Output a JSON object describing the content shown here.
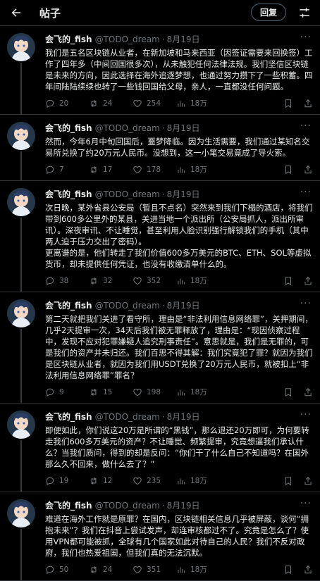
{
  "topbar": {
    "title": "帖子",
    "reply_label": "回复"
  },
  "posts": [
    {
      "name": "会飞的_fish",
      "handle": "@TODO_dream",
      "date": "8月19日",
      "text": "我们是五名区块链从业者，在新加坡和马来西亚（因签证需要来回换签）工作了四年多（中间回国很多次），从未触犯任何法律法规。我们坚信区块链是未来的方向，因此选择在海外追逐梦想，也通过努力攒下了一些积蓄。四年间陆陆续续也转了一些钱回国给父母，亲人，一直都没任何问题。",
      "replies": "20",
      "reposts": "24",
      "likes": "254",
      "views": "18万"
    },
    {
      "name": "会飞的_fish",
      "handle": "@TODO_dream",
      "date": "8月19日",
      "text": "然而，今年6月中旬回国后，噩梦降临。因为生活需要，我们通过某知名交易所兑换了约20万元人民币。没想到，这一小笔交易竟成了导火索。",
      "replies": "7",
      "reposts": "17",
      "likes": "178",
      "views": "18万"
    },
    {
      "name": "会飞的_fish",
      "handle": "@TODO_dream",
      "date": "8月19日",
      "text": "次日晚，某外省县公安局（暂且不点名）突然来到我们下榻的酒店，将我们带到600多公里外的某县，关进当地一个派出所（公安局抓人，派出所审讯）。深夜审讯、不让睡觉，甚至利用人脸识别强行解锁我们的手机（其中两人迫于压力交出了密码）。\n更离谱的是，他们转走了我们价值600多万美元的BTC、ETH、SOL等虚拟货币，却未提供任何凭证，也没有收缴清单什么的。",
      "replies": "38",
      "reposts": "32",
      "likes": "352",
      "views": "18万"
    },
    {
      "name": "会飞的_fish",
      "handle": "@TODO_dream",
      "date": "8月19日",
      "text": "第二天就把我们关进了看守所，理由是“非法利用信息网络罪”，关押期间，几乎2天提审一次，34天后我们被无罪释放了，理由是：“现因侦察过程中，发现不应对犯罪嫌疑人追究刑事责任”。意思就是，我们是无罪的，可是我们的资产并未归还。我们百思不得其解：我们究竟犯了罪？就因为我们是区块链从业者，就因为我们用USDT兑换了20万元人民币，就被扣上“非法利用信息网络罪”罪名？",
      "replies": "9",
      "reposts": "15",
      "likes": "198",
      "views": "18万"
    },
    {
      "name": "会飞的_fish",
      "handle": "@TODO_dream",
      "date": "8月19日",
      "text": "即便如此，你们说这20万是所谓的“黑钱”，那么退还20万即可，为何要转走我们600多万美元的资产？不让睡觉、频繁提审，究竟想逼我们承认什么？当我们质问，得到的却是反问：“你们干了什么自己不知道吗？在国外那么久不回来，做什么去了？”",
      "replies": "19",
      "reposts": "12",
      "likes": "235",
      "views": "18万"
    },
    {
      "name": "会飞的_fish",
      "handle": "@TODO_dream",
      "date": "8月19日",
      "text": "难道在海外工作就是原罪？在国内，区块链相关信息几乎被屏蔽，谈何“拥抱未来”？我们在抖音上尝试发声，却连审核都过不了。究竟是怎么了？使用VPN都可能被抓，全球有几个国家如此对待自己的人民？我们不反对政府，我们也热爱祖国，但我们真的无法沉默。",
      "replies": "50",
      "reposts": "24",
      "likes": "351",
      "views": "18万"
    }
  ]
}
